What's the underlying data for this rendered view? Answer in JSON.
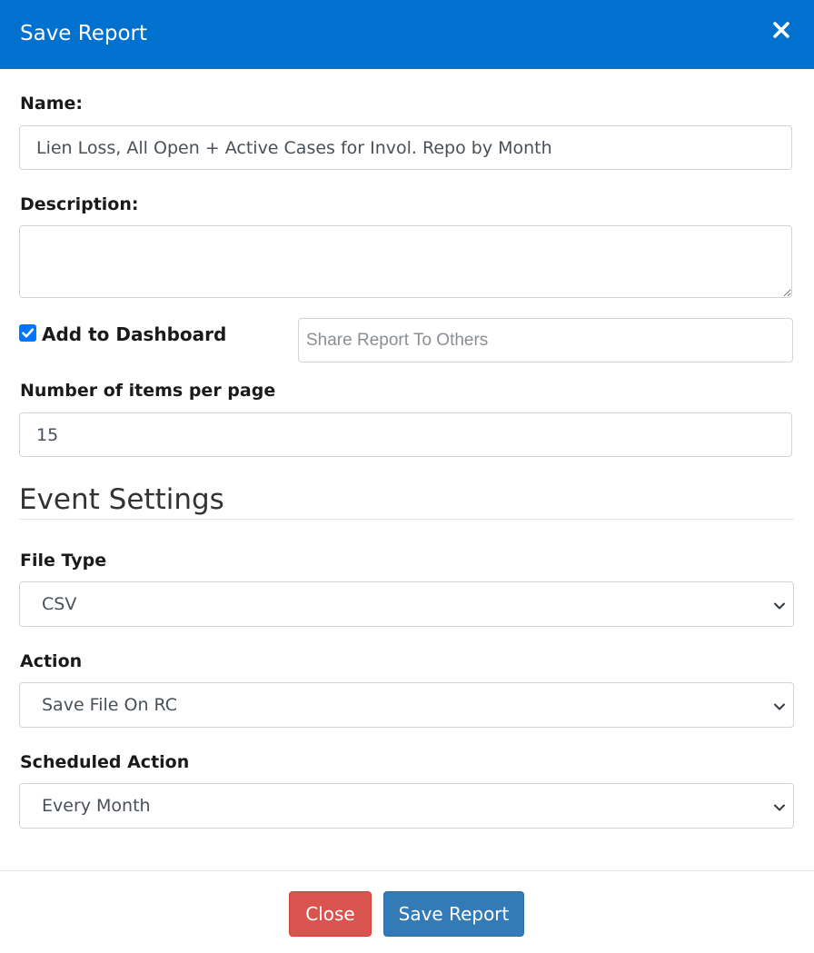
{
  "header": {
    "title": "Save Report",
    "close_icon": "close-icon"
  },
  "form": {
    "name_label": "Name:",
    "name_value": "Lien Loss, All Open + Active Cases for Invol. Repo by Month",
    "description_label": "Description:",
    "description_value": "",
    "add_to_dashboard_label": "Add to Dashboard",
    "add_to_dashboard_checked": true,
    "share_placeholder": "Share Report To Others",
    "items_per_page_label": "Number of items per page",
    "items_per_page_value": "15"
  },
  "event_settings": {
    "title": "Event Settings",
    "file_type_label": "File Type",
    "file_type_value": "CSV",
    "action_label": "Action",
    "action_value": "Save File On RC",
    "scheduled_action_label": "Scheduled Action",
    "scheduled_action_value": "Every Month"
  },
  "footer": {
    "close_label": "Close",
    "save_label": "Save Report"
  },
  "colors": {
    "header_bg": "#0071cf",
    "close_button": "#d9534f",
    "save_button": "#337ab7",
    "checkbox": "#0075ff"
  }
}
